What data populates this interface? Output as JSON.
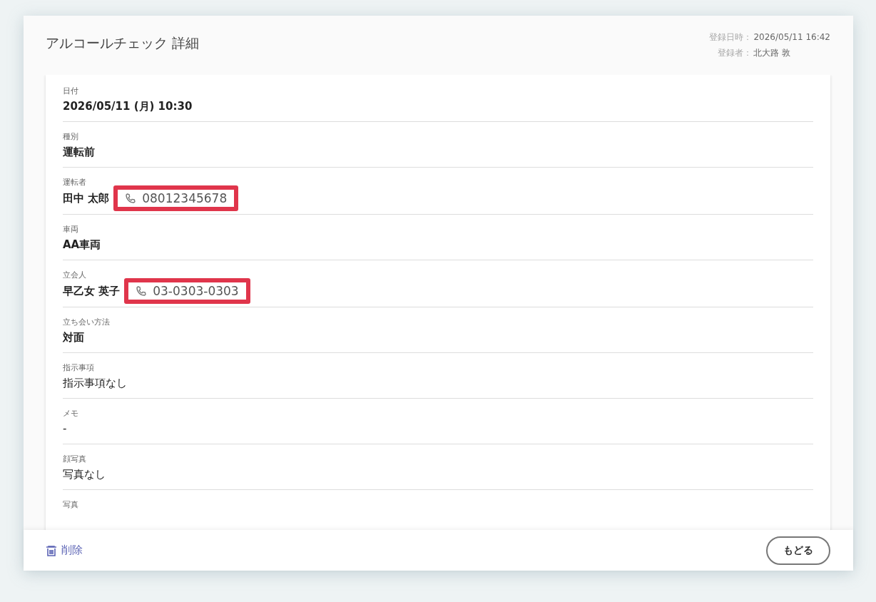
{
  "header": {
    "title": "アルコールチェック 詳細",
    "meta": [
      {
        "label": "登録日時：",
        "value": "2026/05/11 16:42"
      },
      {
        "label": "登録者：",
        "value": "北大路 敦"
      }
    ]
  },
  "fields": [
    {
      "label": "日付",
      "value": "2026/05/11 (月) 10:30",
      "kind": "strong"
    },
    {
      "label": "種別",
      "value": "運転前",
      "kind": "strong"
    },
    {
      "label": "運転者",
      "value": "田中 太郎",
      "kind": "strong",
      "phone": {
        "number": "08012345678",
        "highlighted": true
      }
    },
    {
      "label": "車両",
      "value": "AA車両",
      "kind": "strong"
    },
    {
      "label": "立会人",
      "value": "早乙女 英子",
      "kind": "strong",
      "phone": {
        "number": "03-0303-0303",
        "highlighted": true
      }
    },
    {
      "label": "立ち会い方法",
      "value": "対面",
      "kind": "strong"
    },
    {
      "label": "指示事項",
      "value": "指示事項なし",
      "kind": "plain"
    },
    {
      "label": "メモ",
      "value": "-",
      "kind": "plain"
    },
    {
      "label": "顔写真",
      "value": "写真なし",
      "kind": "plain"
    },
    {
      "label": "写真"
    }
  ],
  "footer": {
    "delete": "削除",
    "back": "もどる"
  }
}
